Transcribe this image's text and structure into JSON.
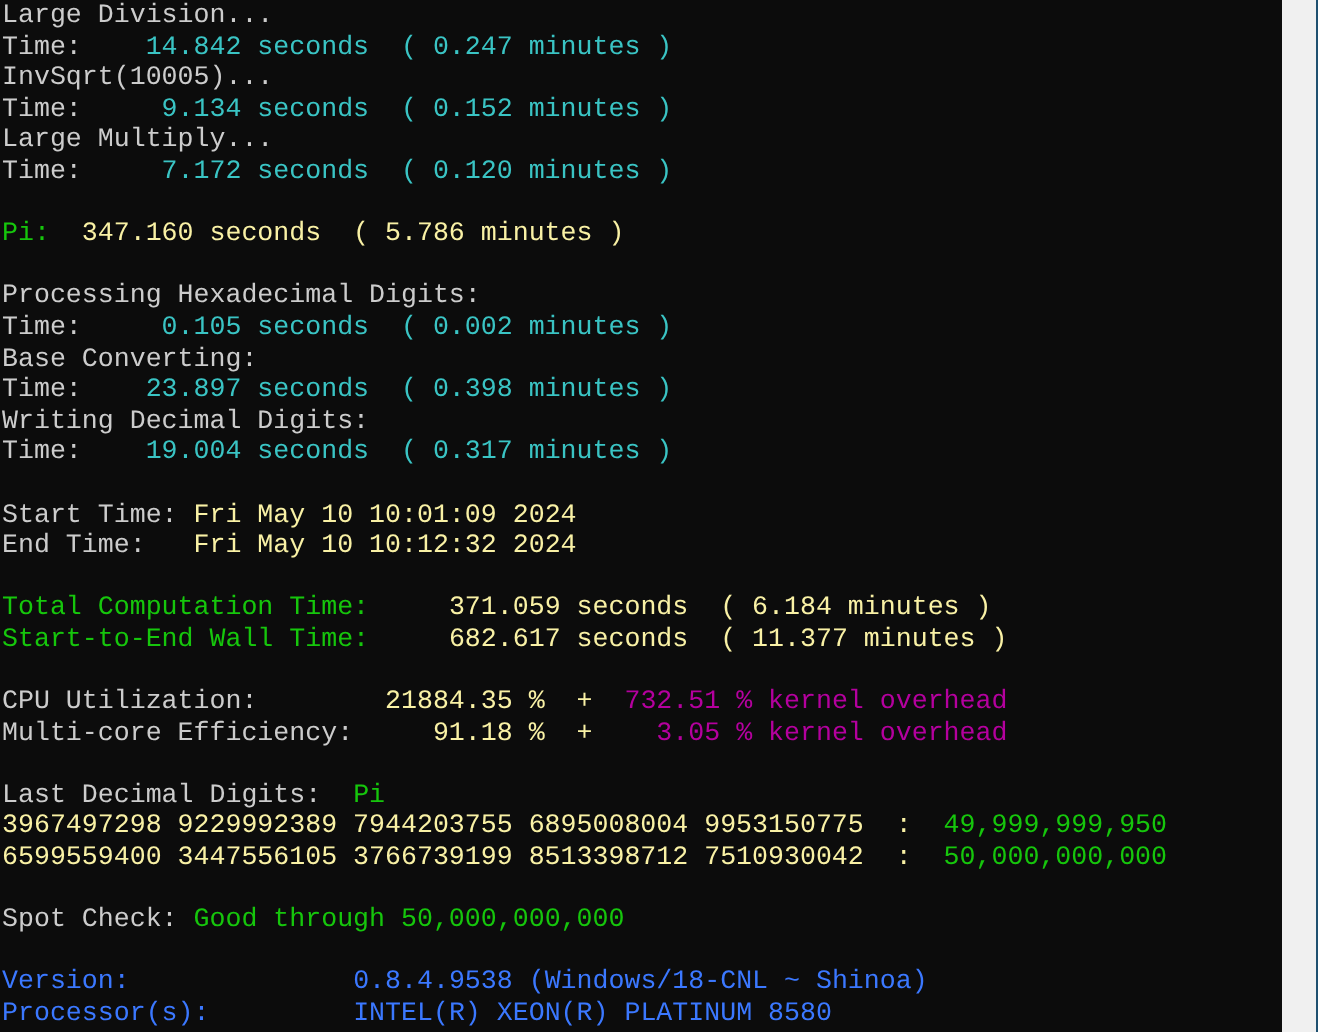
{
  "terminal": {
    "lines": [
      {
        "kind": "text",
        "segments": [
          {
            "text": "Large Division...",
            "color": "#cccccc"
          }
        ]
      },
      {
        "kind": "text",
        "segments": [
          {
            "text": "Time:    ",
            "color": "#cccccc"
          },
          {
            "text": "14.842 seconds  ( 0.247 minutes )",
            "color": "#3ac4c4"
          }
        ]
      },
      {
        "kind": "text",
        "segments": [
          {
            "text": "InvSqrt(10005)...",
            "color": "#cccccc"
          }
        ]
      },
      {
        "kind": "text",
        "segments": [
          {
            "text": "Time:     ",
            "color": "#cccccc"
          },
          {
            "text": "9.134 seconds  ( 0.152 minutes )",
            "color": "#3ac4c4"
          }
        ]
      },
      {
        "kind": "text",
        "segments": [
          {
            "text": "Large Multiply...",
            "color": "#cccccc"
          }
        ]
      },
      {
        "kind": "text",
        "segments": [
          {
            "text": "Time:     ",
            "color": "#cccccc"
          },
          {
            "text": "7.172 seconds  ( 0.120 minutes )",
            "color": "#3ac4c4"
          }
        ]
      },
      {
        "kind": "blank"
      },
      {
        "kind": "text",
        "segments": [
          {
            "text": "Pi:  ",
            "color": "#16c60c"
          },
          {
            "text": "347.160 seconds  ( 5.786 minutes )",
            "color": "#f9f1a5"
          }
        ]
      },
      {
        "kind": "blank"
      },
      {
        "kind": "text",
        "segments": [
          {
            "text": "Processing Hexadecimal Digits:",
            "color": "#cccccc"
          }
        ]
      },
      {
        "kind": "text",
        "segments": [
          {
            "text": "Time:     ",
            "color": "#cccccc"
          },
          {
            "text": "0.105 seconds  ( 0.002 minutes )",
            "color": "#3ac4c4"
          }
        ]
      },
      {
        "kind": "text",
        "segments": [
          {
            "text": "Base Converting:",
            "color": "#cccccc"
          }
        ]
      },
      {
        "kind": "text",
        "segments": [
          {
            "text": "Time:    ",
            "color": "#cccccc"
          },
          {
            "text": "23.897 seconds  ( 0.398 minutes )",
            "color": "#3ac4c4"
          }
        ]
      },
      {
        "kind": "text",
        "segments": [
          {
            "text": "Writing Decimal Digits:",
            "color": "#cccccc"
          }
        ]
      },
      {
        "kind": "text",
        "segments": [
          {
            "text": "Time:    ",
            "color": "#cccccc"
          },
          {
            "text": "19.004 seconds  ( 0.317 minutes )",
            "color": "#3ac4c4"
          }
        ]
      },
      {
        "kind": "blank"
      },
      {
        "kind": "text",
        "segments": [
          {
            "text": "Start Time: ",
            "color": "#cccccc"
          },
          {
            "text": "Fri May 10 10:01:09 2024",
            "color": "#f9f1a5"
          }
        ]
      },
      {
        "kind": "text",
        "segments": [
          {
            "text": "End Time:   ",
            "color": "#cccccc"
          },
          {
            "text": "Fri May 10 10:12:32 2024",
            "color": "#f9f1a5"
          }
        ]
      },
      {
        "kind": "blank"
      },
      {
        "kind": "text",
        "segments": [
          {
            "text": "Total Computation Time:     ",
            "color": "#16c60c"
          },
          {
            "text": "371.059 seconds  ( 6.184 minutes )",
            "color": "#f9f1a5"
          }
        ]
      },
      {
        "kind": "text",
        "segments": [
          {
            "text": "Start-to-End Wall Time:     ",
            "color": "#16c60c"
          },
          {
            "text": "682.617 seconds  ( 11.377 minutes )",
            "color": "#f9f1a5"
          }
        ]
      },
      {
        "kind": "blank"
      },
      {
        "kind": "text",
        "segments": [
          {
            "text": "CPU Utilization:        ",
            "color": "#cccccc"
          },
          {
            "text": "21884.35 %  +  ",
            "color": "#f9f1a5"
          },
          {
            "text": "732.51 % kernel overhead",
            "color": "#b4009e"
          }
        ]
      },
      {
        "kind": "text",
        "segments": [
          {
            "text": "Multi-core Efficiency:     ",
            "color": "#cccccc"
          },
          {
            "text": "91.18 %  +    ",
            "color": "#f9f1a5"
          },
          {
            "text": "3.05 % kernel overhead",
            "color": "#b4009e"
          }
        ]
      },
      {
        "kind": "blank"
      },
      {
        "kind": "text",
        "segments": [
          {
            "text": "Last Decimal Digits:  ",
            "color": "#cccccc"
          },
          {
            "text": "Pi",
            "color": "#16c60c"
          }
        ]
      },
      {
        "kind": "text",
        "segments": [
          {
            "text": "3967497298 9229992389 7944203755 6895008004 9953150775  :  ",
            "color": "#f9f1a5"
          },
          {
            "text": "49,999,999,950",
            "color": "#16c60c"
          }
        ]
      },
      {
        "kind": "text",
        "segments": [
          {
            "text": "6599559400 3447556105 3766739199 8513398712 7510930042  :  ",
            "color": "#f9f1a5"
          },
          {
            "text": "50,000,000,000",
            "color": "#16c60c"
          }
        ]
      },
      {
        "kind": "blank"
      },
      {
        "kind": "text",
        "segments": [
          {
            "text": "Spot Check: ",
            "color": "#cccccc"
          },
          {
            "text": "Good through 50,000,000,000",
            "color": "#16c60c"
          }
        ]
      },
      {
        "kind": "blank"
      },
      {
        "kind": "text",
        "segments": [
          {
            "text": "Version:              ",
            "color": "#3b78ff"
          },
          {
            "text": "0.8.4.9538 (Windows/18-CNL ~ Shinoa)",
            "color": "#3b78ff"
          }
        ]
      },
      {
        "kind": "text",
        "segments": [
          {
            "text": "Processor(s):         ",
            "color": "#3b78ff"
          },
          {
            "text": "INTEL(R) XEON(R) PLATINUM 8580",
            "color": "#3b78ff"
          }
        ]
      }
    ]
  }
}
